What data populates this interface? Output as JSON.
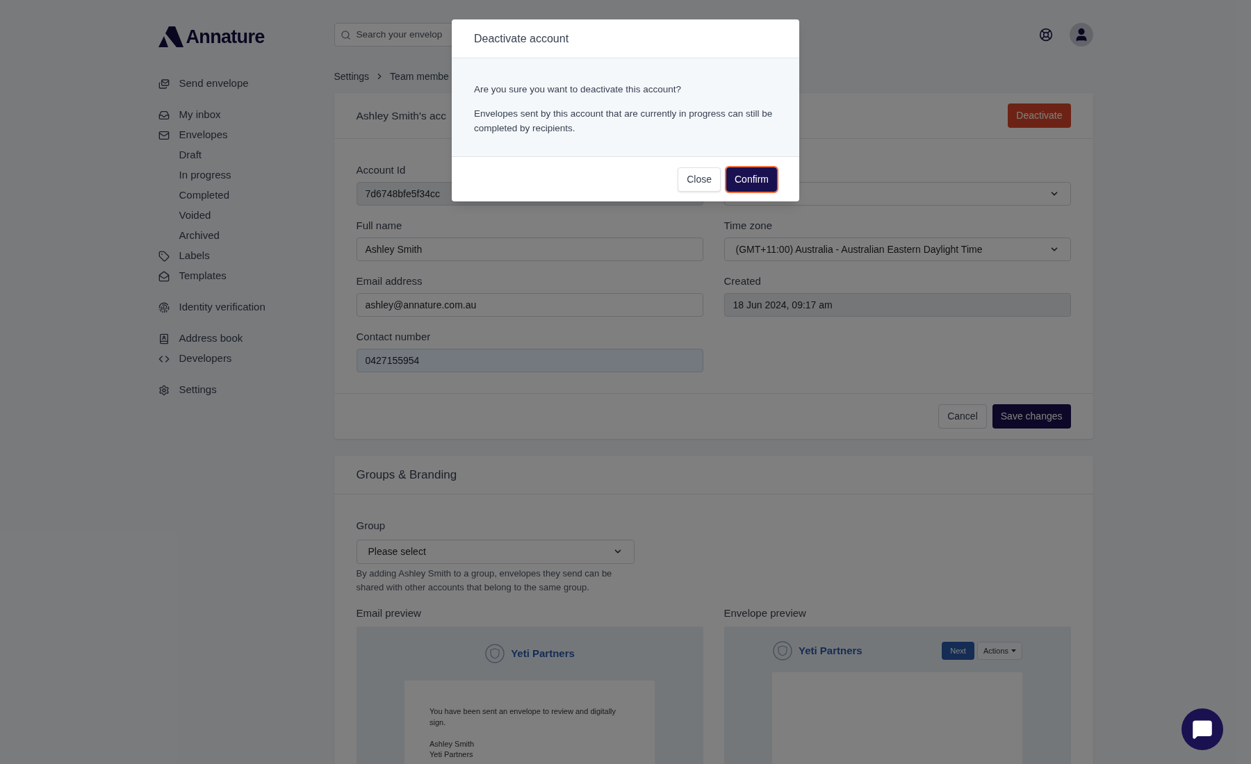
{
  "header": {
    "logo": "Annature",
    "search": {
      "placeholder": "Search your envelop"
    }
  },
  "sidebar": {
    "sections": [
      {
        "items": [
          {
            "label": "Send envelope"
          }
        ]
      },
      {
        "items": [
          {
            "label": "My inbox"
          },
          {
            "label": "Envelopes",
            "children": [
              {
                "label": "Draft"
              },
              {
                "label": "In progress"
              },
              {
                "label": "Completed"
              },
              {
                "label": "Voided"
              },
              {
                "label": "Archived"
              }
            ]
          },
          {
            "label": "Labels"
          },
          {
            "label": "Templates"
          }
        ]
      },
      {
        "items": [
          {
            "label": "Identity verification"
          }
        ]
      },
      {
        "items": [
          {
            "label": "Address book"
          },
          {
            "label": "Developers"
          }
        ]
      },
      {
        "items": [
          {
            "label": "Settings"
          }
        ]
      }
    ]
  },
  "breadcrumb": [
    "Settings",
    "Team membe"
  ],
  "account_card": {
    "title": "Ashley Smith's acc",
    "deactivate_button": "Deactivate",
    "fields": [
      {
        "label": "Account Id",
        "value": "7d6748bfe5f34cc",
        "kind": "readonly"
      },
      {
        "kind": "select"
      },
      {
        "label": "Full name",
        "value": "Ashley Smith",
        "kind": "text"
      },
      {
        "label": "Time zone",
        "value": "(GMT+11:00) Australia - Australian Eastern Daylight Time",
        "kind": "select"
      },
      {
        "label": "Email address",
        "value": "ashley@annature.com.au",
        "kind": "text"
      },
      {
        "label": "Created",
        "value": "18 Jun 2024, 09:17 am",
        "kind": "readonly"
      },
      {
        "label": "Contact number",
        "value": "0427155954",
        "kind": "autofilled"
      }
    ],
    "cancel_button": "Cancel",
    "save_button": "Save changes"
  },
  "groups_card": {
    "title": "Groups & Branding",
    "group_field": {
      "label": "Group",
      "value": "Please select"
    },
    "help": "By adding Ashley Smith to a group, envelopes they send can be shared with other accounts that belong to the same group.",
    "email_preview": {
      "label": "Email preview",
      "brand": "Yeti Partners",
      "message": "You have been sent an envelope to review and digitally sign.",
      "signature": [
        "Ashley Smith",
        "Yeti Partners"
      ]
    },
    "envelope_preview": {
      "label": "Envelope preview",
      "brand": "Yeti Partners",
      "next_button": "Next",
      "actions_button": "Actions"
    }
  },
  "modal": {
    "title": "Deactivate account",
    "body": [
      "Are you sure you want to deactivate this account?",
      "Envelopes sent by this account that are currently in progress can still be completed by recipients."
    ],
    "buttons": [
      {
        "label": "Close",
        "kind": "secondary",
        "focused": false
      },
      {
        "label": "Confirm",
        "kind": "primary",
        "focused": true
      }
    ]
  }
}
